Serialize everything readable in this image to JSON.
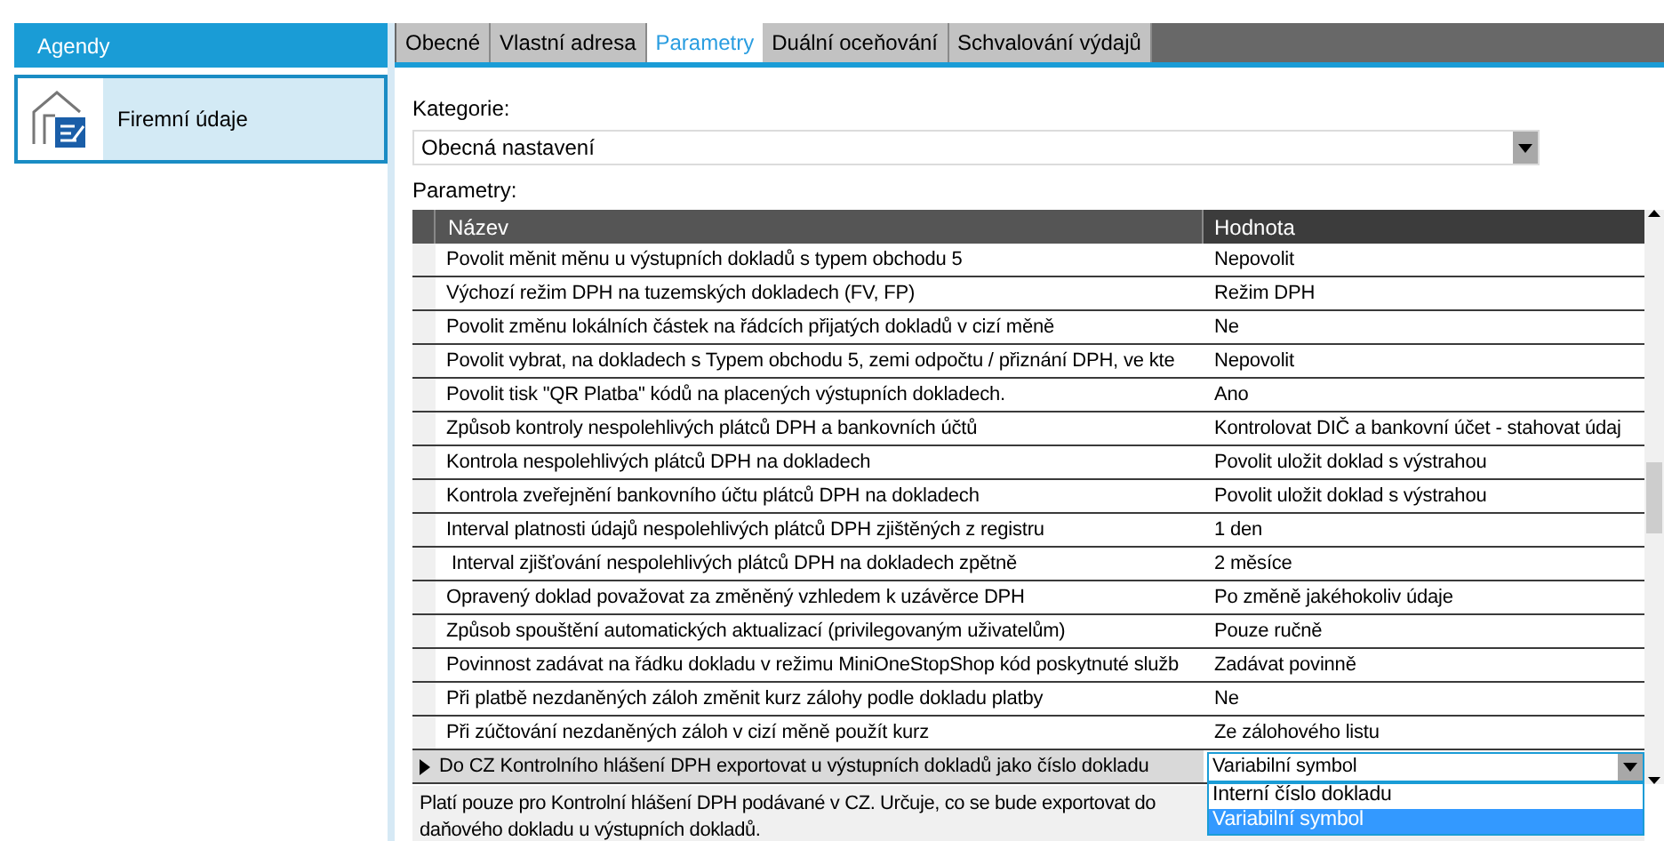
{
  "sidebar": {
    "title": "Agendy",
    "items": [
      {
        "label": "Firemní údaje",
        "selected": true
      }
    ]
  },
  "tabs": [
    {
      "label": "Obecné",
      "selected": false
    },
    {
      "label": "Vlastní adresa",
      "selected": false
    },
    {
      "label": "Parametry",
      "selected": true
    },
    {
      "label": "Duální oceňování",
      "selected": false
    },
    {
      "label": "Schvalování výdajů",
      "selected": false
    }
  ],
  "category": {
    "label": "Kategorie:",
    "value": "Obecná nastavení"
  },
  "parameters": {
    "label": "Parametry:",
    "columns": [
      "Název",
      "Hodnota"
    ],
    "rows": [
      {
        "name": "Povolit měnit měnu u výstupních dokladů s typem obchodu 5",
        "value": "Nepovolit",
        "selected": false
      },
      {
        "name": "Výchozí režim DPH na tuzemských dokladech (FV, FP)",
        "value": "Režim DPH",
        "selected": false
      },
      {
        "name": "Povolit změnu lokálních částek na řádcích přijatých dokladů v cizí měně",
        "value": "Ne",
        "selected": false
      },
      {
        "name": "Povolit vybrat, na dokladech s Typem obchodu 5, zemi odpočtu / přiznání DPH, ve kte",
        "value": "Nepovolit",
        "selected": false
      },
      {
        "name": "Povolit tisk \"QR Platba\" kódů na placených výstupních dokladech.",
        "value": "Ano",
        "selected": false
      },
      {
        "name": "Způsob kontroly nespolehlivých plátců DPH a bankovních účtů",
        "value": "Kontrolovat DIČ a bankovní účet - stahovat údaj",
        "selected": false
      },
      {
        "name": "Kontrola nespolehlivých plátců DPH na dokladech",
        "value": "Povolit uložit doklad s výstrahou",
        "selected": false
      },
      {
        "name": "Kontrola zveřejnění bankovního účtu plátců DPH na dokladech",
        "value": "Povolit uložit doklad s výstrahou",
        "selected": false
      },
      {
        "name": "Interval platnosti údajů nespolehlivých plátců DPH zjištěných z registru",
        "value": "1 den",
        "selected": false
      },
      {
        "name": " Interval zjišťování nespolehlivých plátců DPH na dokladech zpětně",
        "value": "2 měsíce",
        "selected": false
      },
      {
        "name": "Opravený doklad považovat za změněný vzhledem k uzávěrce DPH",
        "value": "Po změně jakéhokoliv údaje",
        "selected": false
      },
      {
        "name": "Způsob spouštění automatických aktualizací (privilegovaným uživatelům)",
        "value": "Pouze ručně",
        "selected": false
      },
      {
        "name": "Povinnost zadávat na řádku dokladu v režimu MiniOneStopShop kód poskytnuté služb",
        "value": "Zadávat povinně",
        "selected": false
      },
      {
        "name": "Při platbě nezdaněných záloh změnit kurz zálohy podle dokladu platby",
        "value": "Ne",
        "selected": false
      },
      {
        "name": "Při zúčtování nezdaněných záloh v cizí měně použít kurz",
        "value": "Ze zálohového listu",
        "selected": false
      },
      {
        "name": "Do CZ Kontrolního hlášení DPH exportovat u výstupních dokladů jako číslo dokladu",
        "value": "Variabilní symbol",
        "selected": true
      }
    ]
  },
  "value_dropdown": {
    "options": [
      {
        "label": "Interní číslo dokladu",
        "selected": false
      },
      {
        "label": "Variabilní symbol",
        "selected": true
      }
    ]
  },
  "description": {
    "lines": [
      "Platí pouze pro Kontrolní hlášení DPH podávané v CZ. Určuje, co se bude exportovat do",
      "daňového dokladu u výstupních dokladů."
    ]
  }
}
